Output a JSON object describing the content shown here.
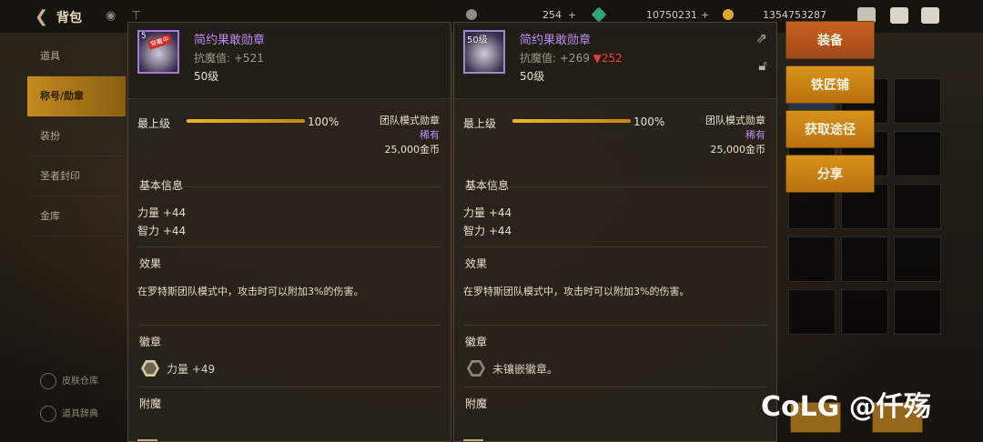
{
  "topbar": {
    "title": "背包",
    "currency1": "254",
    "currency2": "10750231",
    "currency3": "1354753287"
  },
  "leftnav": {
    "items": [
      {
        "label": "道具"
      },
      {
        "label": "称号/勋章"
      },
      {
        "label": "装扮"
      },
      {
        "label": "圣者封印"
      },
      {
        "label": "金库"
      }
    ],
    "bottom1": "皮肤仓库",
    "bottom2": "道具辞典"
  },
  "panels": [
    {
      "icon_level": "5",
      "icon_tag": "穿戴中",
      "name": "简约果敢勋章",
      "stat_label": "抗魔值:",
      "stat_value": "+521",
      "stat_diff": "",
      "level": "50级",
      "max_label": "最上级",
      "progress_pct_text": "100%",
      "progress": 1.0,
      "type": "团队模式勋章",
      "rarity": "稀有",
      "price": "25,000金币",
      "basic_title": "基本信息",
      "attr1": "力量 +44",
      "attr2": "智力 +44",
      "effect_title": "效果",
      "effect_text": "在罗特斯团队模式中，攻击时可以附加3%的伤害。",
      "emblem_title": "徽章",
      "emblem_text": "力量 +49",
      "enchant_title": "附魔"
    },
    {
      "icon_level": "50级",
      "icon_tag": "",
      "name": "简约果敢勋章",
      "stat_label": "抗魔值:",
      "stat_value": "+269",
      "stat_diff": "▼252",
      "level": "50级",
      "max_label": "最上级",
      "progress_pct_text": "100%",
      "progress": 1.0,
      "type": "团队模式勋章",
      "rarity": "稀有",
      "price": "25,000金币",
      "basic_title": "基本信息",
      "attr1": "力量 +44",
      "attr2": "智力 +44",
      "effect_title": "效果",
      "effect_text": "在罗特斯团队模式中，攻击时可以附加3%的伤害。",
      "emblem_title": "徽章",
      "emblem_text": "未镶嵌徽章。",
      "enchant_title": "附魔"
    }
  ],
  "actions": {
    "equip": "装备",
    "smith": "铁匠铺",
    "obtain": "获取途径",
    "share": "分享"
  },
  "watermark": "CoLG @仟殇"
}
